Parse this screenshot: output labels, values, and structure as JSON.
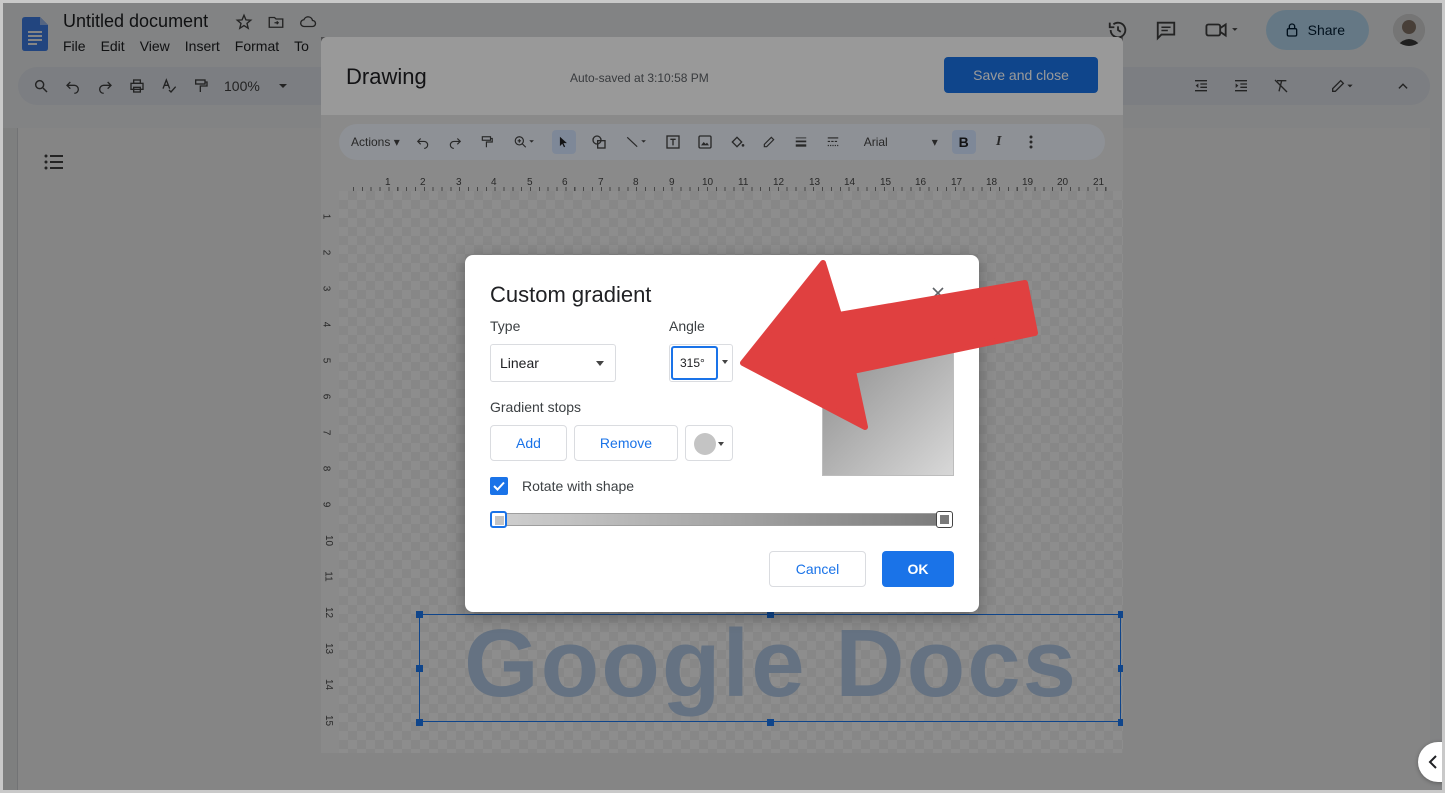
{
  "docs": {
    "doc_title": "Untitled document",
    "menu": [
      "File",
      "Edit",
      "View",
      "Insert",
      "Format",
      "To"
    ],
    "share_label": "Share",
    "zoom": "100%"
  },
  "drawing": {
    "title": "Drawing",
    "autosave": "Auto-saved at 3:10:58 PM",
    "save_close_label": "Save and close",
    "toolbar": {
      "actions_label": "Actions",
      "font": "Arial",
      "bold": "B",
      "italic": "I"
    },
    "ruler_labels": [
      "1",
      "2",
      "3",
      "4",
      "5",
      "6",
      "7",
      "8",
      "9",
      "10",
      "11",
      "12",
      "13",
      "14",
      "15",
      "16",
      "17",
      "18",
      "19",
      "20",
      "21"
    ],
    "vruler_labels": [
      "1",
      "2",
      "3",
      "4",
      "5",
      "6",
      "7",
      "8",
      "9",
      "10",
      "11",
      "12",
      "13",
      "14",
      "15"
    ],
    "wordart_text": "Google Docs"
  },
  "custom_gradient": {
    "title": "Custom gradient",
    "type_label": "Type",
    "type_value": "Linear",
    "angle_label": "Angle",
    "angle_value": "315°",
    "stops_label": "Gradient stops",
    "add_label": "Add",
    "remove_label": "Remove",
    "rotate_label": "Rotate with shape",
    "rotate_checked": true,
    "cancel_label": "Cancel",
    "ok_label": "OK",
    "stop_color": "#c4c4c4"
  },
  "colors": {
    "accent": "#1a73e8",
    "arrow": "#e04040"
  }
}
